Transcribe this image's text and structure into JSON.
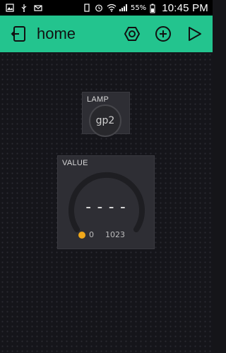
{
  "status_bar": {
    "battery_pct": "55%",
    "time": "10:45 PM"
  },
  "app_bar": {
    "title": "home",
    "icons": [
      "back-icon",
      "settings-hex-icon",
      "add-icon",
      "play-icon"
    ],
    "accent": "#23c48e"
  },
  "canvas": {
    "widgets": {
      "lamp": {
        "label": "LAMP",
        "pin": "gp2"
      },
      "value": {
        "label": "VALUE",
        "display": "----",
        "min": "0",
        "max": "1023",
        "dot_color": "#f0a81a"
      }
    }
  }
}
